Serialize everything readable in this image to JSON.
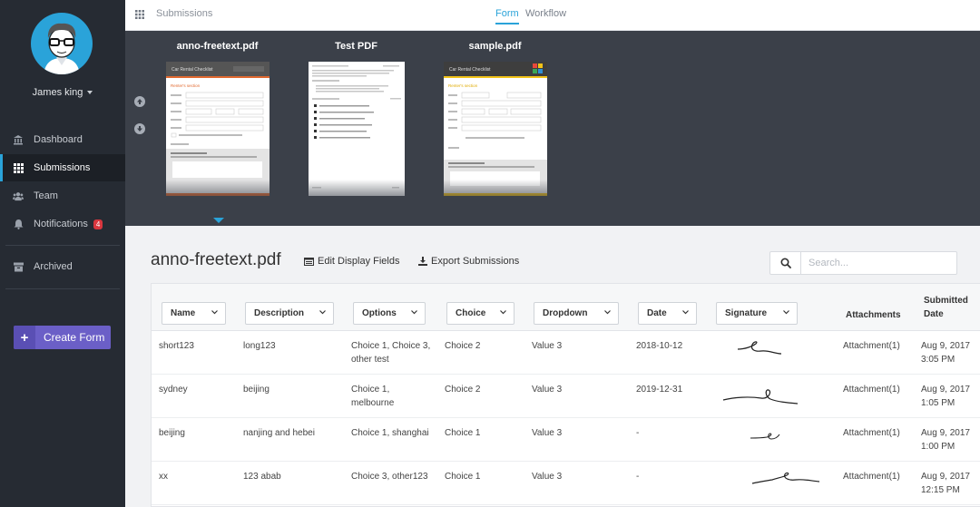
{
  "user": {
    "name": "James king"
  },
  "sidebar": {
    "items": [
      {
        "label": "Dashboard",
        "icon": "bank-icon"
      },
      {
        "label": "Submissions",
        "icon": "grid-icon"
      },
      {
        "label": "Team",
        "icon": "users-icon"
      },
      {
        "label": "Notifications",
        "icon": "bell-icon",
        "badge": "4"
      },
      {
        "label": "Archived",
        "icon": "archive-icon"
      }
    ],
    "create_label": "Create Form"
  },
  "topbar": {
    "breadcrumb": "Submissions",
    "tabs": [
      {
        "label": "Form",
        "active": true
      },
      {
        "label": "Workflow",
        "active": false
      }
    ]
  },
  "documents": [
    {
      "title": "anno-freetext.pdf",
      "thumb_heading": "Car Rental Checklist",
      "thumb_section": "Renter's section",
      "accent": "#e2692f",
      "selected": true
    },
    {
      "title": "Test PDF"
    },
    {
      "title": "sample.pdf",
      "thumb_heading": "Car Rental Checklist",
      "thumb_section": "Renter's section",
      "accent": "#f2c318"
    }
  ],
  "main": {
    "title": "anno-freetext.pdf",
    "edit_fields_label": "Edit Display Fields",
    "export_label": "Export Submissions",
    "search_placeholder": "Search..."
  },
  "table": {
    "columns": [
      "Name",
      "Description",
      "Options",
      "Choice",
      "Dropdown",
      "Date",
      "Signature",
      "Attachments",
      "Submitted Date"
    ],
    "rows": [
      {
        "name": "short123",
        "description": "long123",
        "options": "Choice 1, Choice 3, other test",
        "choice": "Choice 2",
        "dropdown": "Value 3",
        "date": "2018-10-12",
        "attachments": "Attachment(1)",
        "submitted_date": "Aug 9, 2017",
        "submitted_time": "3:05 PM"
      },
      {
        "name": "sydney",
        "description": "beijing",
        "options": "Choice 1, melbourne",
        "choice": "Choice 2",
        "dropdown": "Value 3",
        "date": "2019-12-31",
        "attachments": "Attachment(1)",
        "submitted_date": "Aug 9, 2017",
        "submitted_time": "1:05 PM"
      },
      {
        "name": "beijing",
        "description": "nanjing and hebei",
        "options": "Choice 1, shanghai",
        "choice": "Choice 1",
        "dropdown": "Value 3",
        "date": "-",
        "attachments": "Attachment(1)",
        "submitted_date": "Aug 9, 2017",
        "submitted_time": "1:00 PM"
      },
      {
        "name": "xx",
        "description": "123 abab",
        "options": "Choice 3, other123",
        "choice": "Choice 1",
        "dropdown": "Value 3",
        "date": "-",
        "attachments": "Attachment(1)",
        "submitted_date": "Aug 9, 2017",
        "submitted_time": "12:15 PM"
      }
    ]
  },
  "colors": {
    "accent": "#2aa3d9",
    "primary_button": "#6b5fc7",
    "badge": "#d9363e",
    "sidebar": "#262b33"
  }
}
